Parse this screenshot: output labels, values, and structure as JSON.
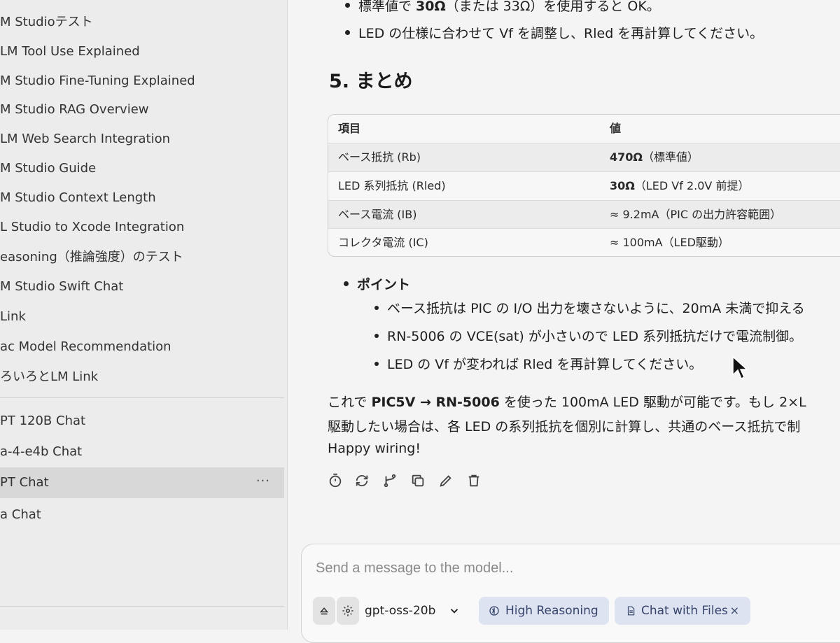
{
  "sidebar": {
    "items": [
      {
        "label": "M Studioテスト"
      },
      {
        "label": "LM Tool Use Explained"
      },
      {
        "label": "M Studio Fine-Tuning Explained"
      },
      {
        "label": "M Studio RAG Overview"
      },
      {
        "label": "LM Web Search Integration"
      },
      {
        "label": "M Studio Guide"
      },
      {
        "label": "M Studio Context Length"
      },
      {
        "label": "L Studio to Xcode Integration"
      },
      {
        "label": "easoning（推論強度）のテスト"
      },
      {
        "label": "M Studio Swift Chat"
      },
      {
        "label": "Link"
      },
      {
        "label": "ac Model Recommendation"
      },
      {
        "label": "ろいろとLM Link"
      }
    ],
    "recent": [
      {
        "label": "PT 120B Chat"
      },
      {
        "label": "a-4-e4b Chat"
      },
      {
        "label": "PT Chat",
        "more": "···"
      },
      {
        "label": "a Chat"
      }
    ]
  },
  "content": {
    "top_bullets": [
      {
        "pre": "標準値で ",
        "bold": "30Ω",
        "post": "（または 33Ω）を使用すると OK。"
      },
      {
        "text": "LED の仕様に合わせて Vf を調整し、Rled を再計算してください。"
      }
    ],
    "section_title": "5. まとめ",
    "table": {
      "headers": [
        "項目",
        "値"
      ],
      "rows": [
        {
          "item": "ベース抵抗 (Rb)",
          "value_bold": "470Ω",
          "value_rest": "（標準値）"
        },
        {
          "item": "LED 系列抵抗 (Rled)",
          "value_bold": "30Ω",
          "value_rest": "（LED Vf 2.0V 前提）"
        },
        {
          "item": "ベース電流 (IB)",
          "value_bold": "",
          "value_rest": "≈ 9.2mA（PIC の出力許容範囲）"
        },
        {
          "item": "コレクタ電流 (IC)",
          "value_bold": "",
          "value_rest": "≈ 100mA（LED駆動）"
        }
      ]
    },
    "point_title": "ポイント",
    "points": [
      "ベース抵抗は PIC の I/O 出力を壊さないように、20mA 未満で抑える",
      "RN-5006 の VCE(sat) が小さいので LED 系列抵抗だけで電流制御。",
      "LED の Vf が変われば Rled を再計算してください。"
    ],
    "closing": {
      "line1_pre": "これで ",
      "line1_bold": "PIC5V → RN-5006",
      "line1_post": " を使った 100mA LED 駆動が可能です。もし 2×L",
      "line2": "駆動したい場合は、各 LED の系列抵抗を個別に計算し、共通のベース抵抗で制",
      "line3": "Happy wiring!"
    },
    "action_icons": [
      "timer-icon",
      "regenerate-icon",
      "branch-icon",
      "copy-icon",
      "edit-icon",
      "delete-icon"
    ]
  },
  "composer": {
    "placeholder": "Send a message to the model...",
    "model": "gpt-oss-20b",
    "reasoning_label": "High Reasoning",
    "files_label": "Chat with Files",
    "close": "×"
  }
}
